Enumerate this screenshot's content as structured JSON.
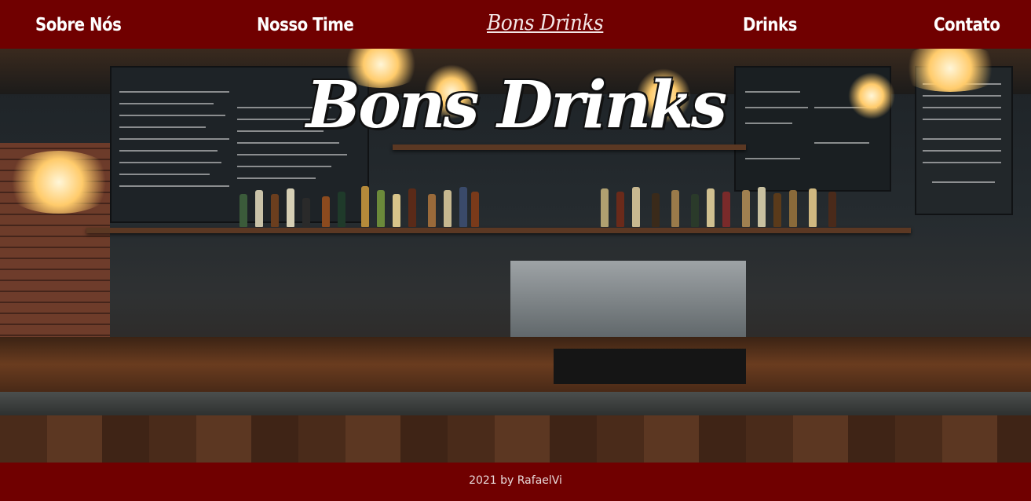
{
  "nav": {
    "items": [
      {
        "label": "Sobre Nós"
      },
      {
        "label": "Nosso Time"
      },
      {
        "label": "Drinks"
      },
      {
        "label": "Contato"
      }
    ],
    "logo": "Bons Drinks"
  },
  "hero": {
    "title": "Bons Drinks",
    "image_description_icon": "bar-photo"
  },
  "footer": {
    "text": "2021 by RafaelVi"
  },
  "colors": {
    "brand": "#700000",
    "text": "#ffffff"
  }
}
